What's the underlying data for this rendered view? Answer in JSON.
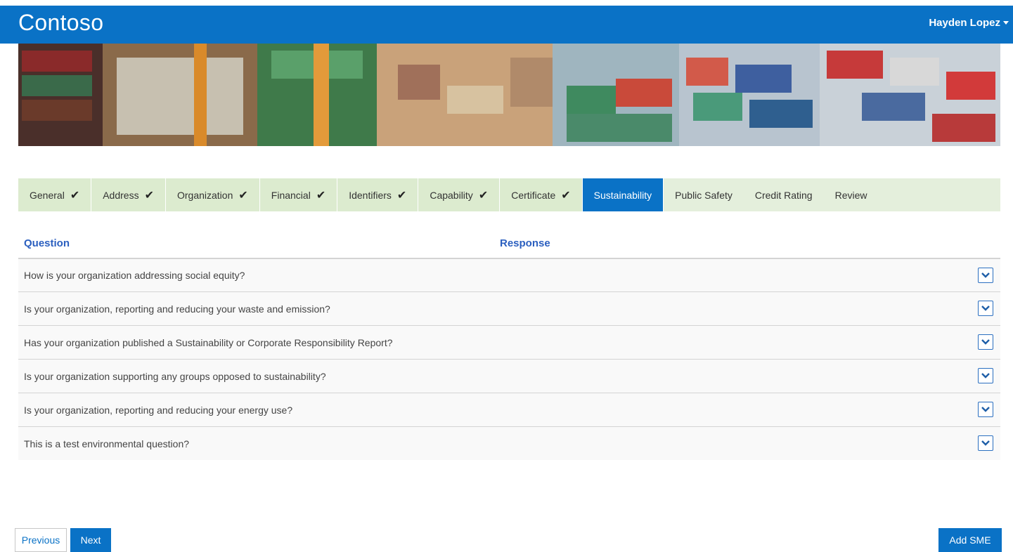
{
  "header": {
    "brand": "Contoso",
    "user_name": "Hayden Lopez",
    "bar_color": "#0a72c6"
  },
  "tabs": [
    {
      "label": "General",
      "completed": true,
      "active": false
    },
    {
      "label": "Address",
      "completed": true,
      "active": false
    },
    {
      "label": "Organization",
      "completed": true,
      "active": false
    },
    {
      "label": "Financial",
      "completed": true,
      "active": false
    },
    {
      "label": "Identifiers",
      "completed": true,
      "active": false
    },
    {
      "label": "Capability",
      "completed": true,
      "active": false
    },
    {
      "label": "Certificate",
      "completed": true,
      "active": false
    },
    {
      "label": "Sustainability",
      "completed": false,
      "active": true
    },
    {
      "label": "Public Safety",
      "completed": false,
      "active": false
    },
    {
      "label": "Credit Rating",
      "completed": false,
      "active": false
    },
    {
      "label": "Review",
      "completed": false,
      "active": false
    }
  ],
  "check_mark": "✔",
  "table": {
    "columns": {
      "question": "Question",
      "response": "Response"
    },
    "rows": [
      {
        "question": "How is your organization addressing social equity?"
      },
      {
        "question": "Is your organization, reporting and reducing your waste and emission?"
      },
      {
        "question": "Has your organization published a Sustainability or Corporate Responsibility Report?"
      },
      {
        "question": "Is your organization supporting any groups opposed to sustainability?"
      },
      {
        "question": "Is your organization, reporting and reducing your energy use?"
      },
      {
        "question": "This is a test environmental question?"
      }
    ]
  },
  "footer": {
    "previous_label": "Previous",
    "next_label": "Next",
    "add_sme_label": "Add SME"
  },
  "icons": {
    "expand": "chevron-down-icon",
    "user_menu": "caret-down-icon"
  }
}
